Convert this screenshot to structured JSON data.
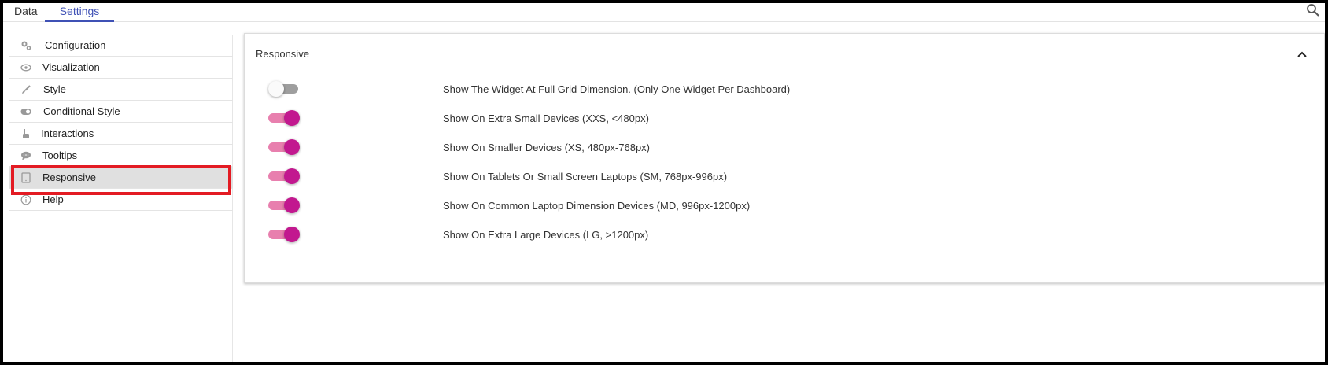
{
  "tabs": [
    {
      "label": "Data",
      "active": false
    },
    {
      "label": "Settings",
      "active": true
    }
  ],
  "accent_color": "#3f51b5",
  "toggle_on_color": "#c2188f",
  "sidebar": {
    "items": [
      {
        "label": "Configuration",
        "icon": "gears-icon"
      },
      {
        "label": "Visualization",
        "icon": "eye-icon"
      },
      {
        "label": "Style",
        "icon": "brush-icon"
      },
      {
        "label": "Conditional Style",
        "icon": "toggle-icon"
      },
      {
        "label": "Interactions",
        "icon": "pointer-hand-icon"
      },
      {
        "label": "Tooltips",
        "icon": "chat-bubble-icon"
      },
      {
        "label": "Responsive",
        "icon": "tablet-icon",
        "active": true
      },
      {
        "label": "Help",
        "icon": "info-icon"
      }
    ]
  },
  "panel": {
    "title": "Responsive",
    "options": [
      {
        "label": "Show The Widget At Full Grid Dimension. (Only One Widget Per Dashboard)",
        "enabled": false
      },
      {
        "label": "Show On Extra Small Devices (XXS, <480px)",
        "enabled": true
      },
      {
        "label": "Show On Smaller Devices (XS, 480px-768px)",
        "enabled": true
      },
      {
        "label": "Show On Tablets Or Small Screen Laptops (SM, 768px-996px)",
        "enabled": true
      },
      {
        "label": "Show On Common Laptop Dimension Devices (MD, 996px-1200px)",
        "enabled": true
      },
      {
        "label": "Show On Extra Large Devices (LG, >1200px)",
        "enabled": true
      }
    ]
  }
}
